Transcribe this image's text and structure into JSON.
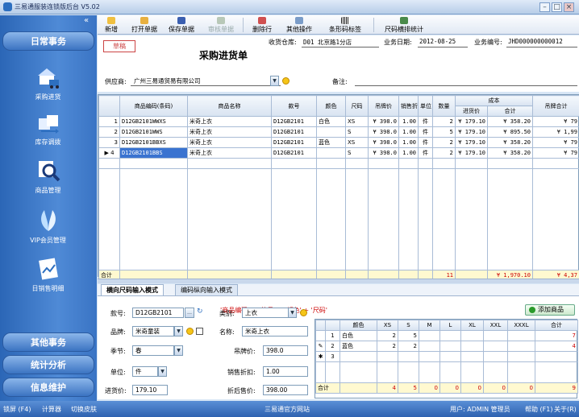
{
  "window": {
    "title": "三易通服装连锁版后台 V5.02"
  },
  "sidebar": {
    "categories_top": [
      "日常事务"
    ],
    "modules": [
      {
        "label": "采购进货",
        "icon": "house-truck-icon"
      },
      {
        "label": "库存调拨",
        "icon": "warehouse-transfer-icon"
      },
      {
        "label": "商品管理",
        "icon": "magnifier-icon"
      },
      {
        "label": "VIP会员管理",
        "icon": "leaf-icon"
      },
      {
        "label": "日销售明细",
        "icon": "chart-doc-icon"
      }
    ],
    "categories_bottom": [
      "其他事务",
      "统计分析",
      "信息维护"
    ]
  },
  "toolbar": {
    "new": "新增",
    "open": "打开单据",
    "save": "保存单据",
    "audit": "审核单据",
    "delete_row": "删除行",
    "other": "其他操作",
    "barcode_label": "条形码标签",
    "size_stats": "尺码横排统计"
  },
  "form": {
    "stamp": "草稿",
    "title": "采购进货单",
    "warehouse_label": "收货仓库:",
    "warehouse_value": "D01 北京路1分店",
    "date_label": "业务日期:",
    "date_value": "2012-08-25",
    "docno_label": "业务编号:",
    "docno_value": "JHD000000000012",
    "supplier_label": "供应商:",
    "supplier_value": "广州三易通贸易有限公司",
    "remark_label": "备注:"
  },
  "grid": {
    "headers": [
      "商品编码(条码)",
      "商品名称",
      "款号",
      "颜色",
      "尺码",
      "吊牌价",
      "销售折扣",
      "单位",
      "数量",
      "进货价",
      "合计",
      "吊牌合计"
    ],
    "group_header": "成本",
    "rows": [
      {
        "no": "1",
        "code": "D12GB2101WWXS",
        "name": "米奇上衣",
        "style": "D12GB2101",
        "color": "白色",
        "size": "XS",
        "tag": "¥ 398.0",
        "disc": "1.00",
        "unit": "件",
        "qty": "2",
        "cost": "¥ 179.10",
        "total": "¥ 358.20",
        "tagtotal": "¥ 79"
      },
      {
        "no": "2",
        "code": "D12GB2101WWS",
        "name": "米奇上衣",
        "style": "D12GB2101",
        "color": "",
        "size": "S",
        "tag": "¥ 398.0",
        "disc": "1.00",
        "unit": "件",
        "qty": "5",
        "cost": "¥ 179.10",
        "total": "¥ 895.50",
        "tagtotal": "¥ 1,99"
      },
      {
        "no": "3",
        "code": "D12GB2101BBXS",
        "name": "米奇上衣",
        "style": "D12GB2101",
        "color": "蓝色",
        "size": "XS",
        "tag": "¥ 398.0",
        "disc": "1.00",
        "unit": "件",
        "qty": "2",
        "cost": "¥ 179.10",
        "total": "¥ 358.20",
        "tagtotal": "¥ 79"
      },
      {
        "no": "4",
        "code": "D12GB2101BBS",
        "name": "米奇上衣",
        "style": "D12GB2101",
        "color": "",
        "size": "S",
        "tag": "¥ 398.0",
        "disc": "1.00",
        "unit": "件",
        "qty": "2",
        "cost": "¥ 179.10",
        "total": "¥ 358.20",
        "tagtotal": "¥ 79"
      }
    ],
    "footer": {
      "label": "合计",
      "qty": "11",
      "total": "¥ 1,970.10",
      "tagtotal": "¥ 4,37"
    }
  },
  "bottom": {
    "tabs": [
      "横向尺码输入模式",
      "编码纵向输入模式"
    ],
    "formula": "'商品编码' = '款号' + '颜色' + '尺码'",
    "add_button": "添加商品",
    "fields": {
      "style_label": "款号:",
      "style_value": "D12GB2101",
      "category_label": "类别:",
      "category_value": "上衣",
      "brand_label": "品牌:",
      "brand_value": "米奇童装",
      "name_label": "名称:",
      "name_value": "米奇上衣",
      "season_label": "季节:",
      "season_value": "春",
      "tagprice_label": "吊牌价:",
      "tagprice_value": "398.0",
      "unit_label": "单位:",
      "unit_value": "件",
      "disc_label": "销售折扣:",
      "disc_value": "1.00",
      "cost_label": "进货价:",
      "cost_value": "179.10",
      "saleprice_label": "折后售价:",
      "saleprice_value": "398.00"
    },
    "size_grid": {
      "headers": [
        "颜色",
        "XS",
        "S",
        "M",
        "L",
        "XL",
        "XXL",
        "XXXL",
        "合计"
      ],
      "rows": [
        {
          "no": "1",
          "color": "白色",
          "XS": "2",
          "S": "5",
          "total": "7"
        },
        {
          "no": "2",
          "color": "蓝色",
          "XS": "2",
          "S": "2",
          "total": "4"
        },
        {
          "no": "3",
          "color": "",
          "XS": "",
          "S": "",
          "total": ""
        }
      ],
      "footer": {
        "label": "合计",
        "XS": "4",
        "S": "5",
        "M": "0",
        "L": "0",
        "XL": "0",
        "XXL": "0",
        "XXXL": "0",
        "total": "9"
      }
    }
  },
  "statusbar": {
    "lock": "锁屏 (F4)",
    "calc": "计算器",
    "skin": "切换皮肤",
    "site": "三易通官方网站",
    "user": "用户: ADMIN 管理员",
    "help": "帮助 (F1)",
    "about": "关于(R)"
  },
  "colors": {
    "sidebar": "#3a74c4",
    "accent": "#2d6fc0",
    "draft": "#cc4444",
    "total_yellow": "#fff9d0",
    "red_total": "#cc0000"
  }
}
